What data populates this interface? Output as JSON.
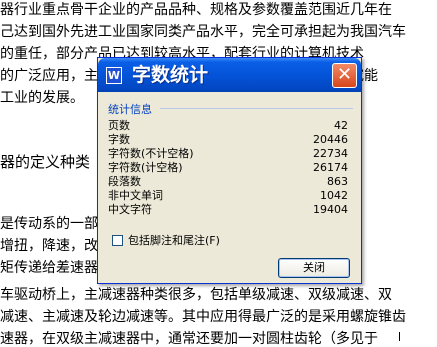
{
  "document": {
    "lines": [
      "器行业重点骨干企业的产品品种、规格及参数覆盖范围近几年在",
      "己达到国外先进工业国家同类产品水平，完全可承担起为我国汽车",
      "的重任，部分产品已达到较高水平，配套行业的计算机技术",
      "的广泛应用，主减速器技术得到长足发展，主减速器的研究能",
      "工业的发展。",
      "器的定义种类",
      "是传动系的一部分，它与差速器、半轴等共同组成驱",
      "增扭，降速，改变转矩传递方向，主减速器直接从变速",
      "矩传递给差速器。",
      "车驱动桥上，主减速器种类很多，包括单级减速、双级减速、双",
      "减速、主减速及轮边减速等。其中应用得最广泛的是采用螺旋锥齿",
      "速器，在双级主减速器中，通常还要加一对圆柱齿轮（多见于"
    ]
  },
  "dialog": {
    "title": "字数统计",
    "app_icon": "W",
    "close_icon_glyph": "✕",
    "group_label": "统计信息",
    "stats": [
      {
        "label": "页数",
        "value": "42"
      },
      {
        "label": "字数",
        "value": "20446"
      },
      {
        "label": "字符数(不计空格)",
        "value": "22734"
      },
      {
        "label": "字符数(计空格)",
        "value": "26174"
      },
      {
        "label": "段落数",
        "value": "863"
      },
      {
        "label": "非中文单词",
        "value": "1042"
      },
      {
        "label": "中文字符",
        "value": "19404"
      }
    ],
    "checkbox_label": "包括脚注和尾注(F)",
    "checkbox_checked": false,
    "close_button_label": "关闭"
  }
}
